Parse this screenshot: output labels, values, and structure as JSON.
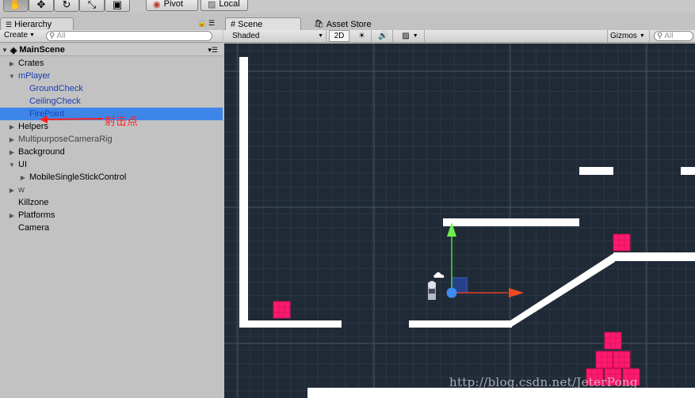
{
  "toolbar": {
    "tools": [
      "hand-icon",
      "move-icon",
      "rotate-icon",
      "scale-icon",
      "rect-icon"
    ],
    "pivot_label": "Pivot",
    "local_label": "Local"
  },
  "hierarchy": {
    "tab_label": "Hierarchy",
    "create_label": "Create",
    "search_placeholder": "All",
    "scene_name": "MainScene",
    "items": [
      {
        "label": "Crates",
        "indent": 0,
        "arrow": "collapsed",
        "color": "#000000"
      },
      {
        "label": "mPlayer",
        "indent": 0,
        "arrow": "expanded",
        "color": "#1a3bb0"
      },
      {
        "label": "GroundCheck",
        "indent": 1,
        "arrow": "none",
        "color": "#1a3bb0"
      },
      {
        "label": "CeilingCheck",
        "indent": 1,
        "arrow": "none",
        "color": "#1a3bb0"
      },
      {
        "label": "FirePoint",
        "indent": 1,
        "arrow": "none",
        "color": "#1a3bb0",
        "selected": true
      },
      {
        "label": "Helpers",
        "indent": 0,
        "arrow": "collapsed",
        "color": "#000000"
      },
      {
        "label": "MultipurposeCameraRig",
        "indent": 0,
        "arrow": "collapsed",
        "color": "#444444"
      },
      {
        "label": "Background",
        "indent": 0,
        "arrow": "collapsed",
        "color": "#000000"
      },
      {
        "label": "UI",
        "indent": 0,
        "arrow": "expanded",
        "color": "#000000"
      },
      {
        "label": "MobileSingleStickControl",
        "indent": 1,
        "arrow": "collapsed",
        "color": "#000000"
      },
      {
        "label": "w",
        "indent": 0,
        "arrow": "collapsed",
        "color": "#444444"
      },
      {
        "label": "Killzone",
        "indent": 0,
        "arrow": "none",
        "color": "#000000"
      },
      {
        "label": "Platforms",
        "indent": 0,
        "arrow": "collapsed",
        "color": "#000000"
      },
      {
        "label": "Camera",
        "indent": 0,
        "arrow": "none",
        "color": "#000000"
      }
    ],
    "annotation_text": "射击点",
    "annotation_color": "#ff2020"
  },
  "scene": {
    "tab_label": "Scene",
    "asset_store_label": "Asset Store",
    "shading_mode": "Shaded",
    "mode_2d_label": "2D",
    "gizmos_label": "Gizmos",
    "search_placeholder": "All",
    "background_color": "#1f2a36",
    "platform_color": "#ffffff",
    "crate_color": "#ff1a6e",
    "watermark": "http://blog.csdn.net/JeterPong"
  }
}
